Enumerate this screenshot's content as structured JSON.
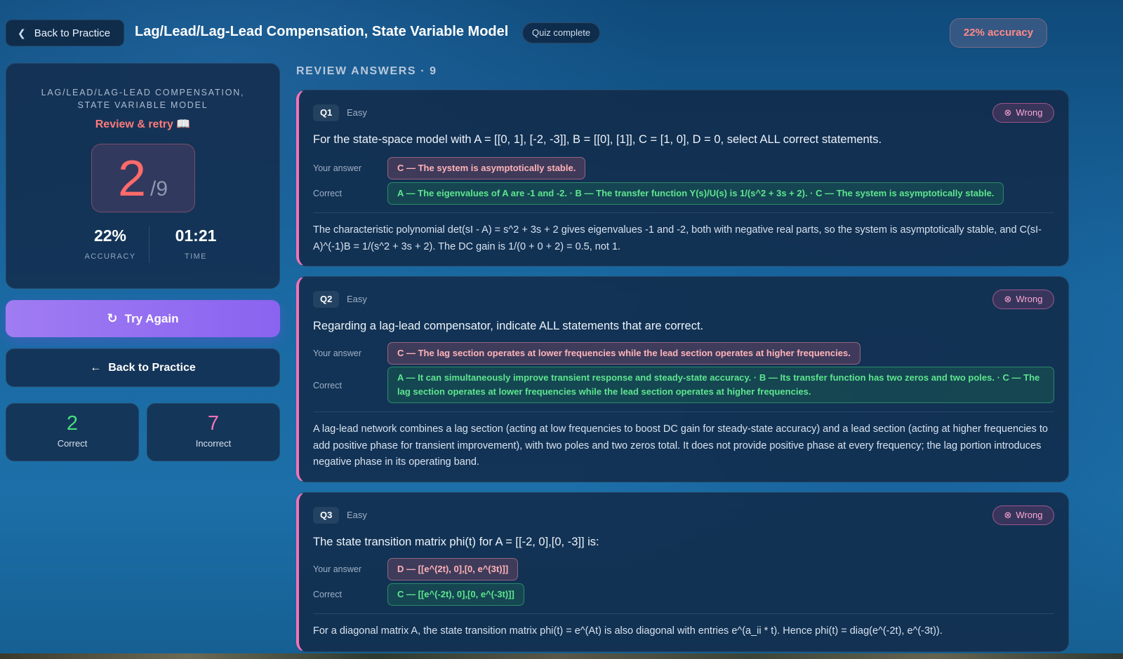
{
  "header": {
    "back_label": "Back to Practice",
    "title": "Lag/Lead/Lag-Lead Compensation, State Variable Model",
    "status": "Quiz complete",
    "accuracy_pill": "22% accuracy"
  },
  "summary": {
    "topic": "LAG/LEAD/LAG-LEAD COMPENSATION, STATE VARIABLE MODEL",
    "retry_text": "Review & retry 📖",
    "score": "2",
    "total": "/9",
    "accuracy_value": "22%",
    "accuracy_label": "ACCURACY",
    "time_value": "01:21",
    "time_label": "TIME"
  },
  "actions": {
    "try_again": "Try Again",
    "back": "Back to Practice"
  },
  "counts": {
    "correct_value": "2",
    "correct_label": "Correct",
    "incorrect_value": "7",
    "incorrect_label": "Incorrect"
  },
  "review": {
    "heading": "REVIEW ANSWERS · 9",
    "your_answer_label": "Your answer",
    "correct_label": "Correct",
    "wrong_label": "Wrong",
    "questions": [
      {
        "num": "Q1",
        "difficulty": "Easy",
        "text": "For the state-space model with A = [[0, 1], [-2, -3]], B = [[0], [1]], C = [1, 0], D = 0, select ALL correct statements.",
        "your_answer": "C — The system is asymptotically stable.",
        "correct": "A — The eigenvalues of A are -1 and -2. · B — The transfer function Y(s)/U(s) is 1/(s^2 + 3s + 2). · C — The system is asymptotically stable.",
        "explanation": "The characteristic polynomial det(sI - A) = s^2 + 3s + 2 gives eigenvalues -1 and -2, both with negative real parts, so the system is asymptotically stable, and C(sI-A)^(-1)B = 1/(s^2 + 3s + 2). The DC gain is 1/(0 + 0 + 2) = 0.5, not 1."
      },
      {
        "num": "Q2",
        "difficulty": "Easy",
        "text": "Regarding a lag-lead compensator, indicate ALL statements that are correct.",
        "your_answer": "C — The lag section operates at lower frequencies while the lead section operates at higher frequencies.",
        "correct": "A — It can simultaneously improve transient response and steady-state accuracy. · B — Its transfer function has two zeros and two poles. · C — The lag section operates at lower frequencies while the lead section operates at higher frequencies.",
        "explanation": "A lag-lead network combines a lag section (acting at low frequencies to boost DC gain for steady-state accuracy) and a lead section (acting at higher frequencies to add positive phase for transient improvement), with two poles and two zeros total. It does not provide positive phase at every frequency; the lag portion introduces negative phase in its operating band."
      },
      {
        "num": "Q3",
        "difficulty": "Easy",
        "text": "The state transition matrix phi(t) for A = [[-2, 0],[0, -3]] is:",
        "your_answer": "D — [[e^(2t), 0],[0, e^(3t)]]",
        "correct": "C — [[e^(-2t), 0],[0, e^(-3t)]]",
        "explanation": "For a diagonal matrix A, the state transition matrix phi(t) = e^(At) is also diagonal with entries e^(a_ii * t). Hence phi(t) = diag(e^(-2t), e^(-3t))."
      }
    ]
  }
}
